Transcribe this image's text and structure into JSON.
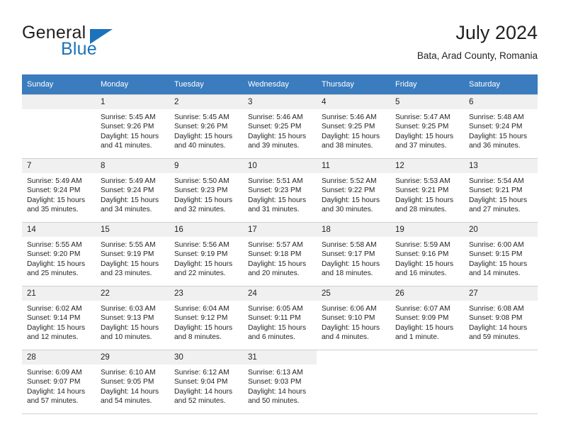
{
  "brand": {
    "word1": "General",
    "word2": "Blue",
    "accent_color": "#1c72bb",
    "logo_icon": "triangle-icon"
  },
  "header": {
    "title": "July 2024",
    "subtitle": "Bata, Arad County, Romania"
  },
  "calendar": {
    "header_bg": "#3a7cbe",
    "daynum_bg": "#f0f0f0",
    "weekday_headers": [
      "Sunday",
      "Monday",
      "Tuesday",
      "Wednesday",
      "Thursday",
      "Friday",
      "Saturday"
    ],
    "weeks": [
      [
        {
          "day": "",
          "lines": []
        },
        {
          "day": "1",
          "lines": [
            "Sunrise: 5:45 AM",
            "Sunset: 9:26 PM",
            "Daylight: 15 hours",
            "and 41 minutes."
          ]
        },
        {
          "day": "2",
          "lines": [
            "Sunrise: 5:45 AM",
            "Sunset: 9:26 PM",
            "Daylight: 15 hours",
            "and 40 minutes."
          ]
        },
        {
          "day": "3",
          "lines": [
            "Sunrise: 5:46 AM",
            "Sunset: 9:25 PM",
            "Daylight: 15 hours",
            "and 39 minutes."
          ]
        },
        {
          "day": "4",
          "lines": [
            "Sunrise: 5:46 AM",
            "Sunset: 9:25 PM",
            "Daylight: 15 hours",
            "and 38 minutes."
          ]
        },
        {
          "day": "5",
          "lines": [
            "Sunrise: 5:47 AM",
            "Sunset: 9:25 PM",
            "Daylight: 15 hours",
            "and 37 minutes."
          ]
        },
        {
          "day": "6",
          "lines": [
            "Sunrise: 5:48 AM",
            "Sunset: 9:24 PM",
            "Daylight: 15 hours",
            "and 36 minutes."
          ]
        }
      ],
      [
        {
          "day": "7",
          "lines": [
            "Sunrise: 5:49 AM",
            "Sunset: 9:24 PM",
            "Daylight: 15 hours",
            "and 35 minutes."
          ]
        },
        {
          "day": "8",
          "lines": [
            "Sunrise: 5:49 AM",
            "Sunset: 9:24 PM",
            "Daylight: 15 hours",
            "and 34 minutes."
          ]
        },
        {
          "day": "9",
          "lines": [
            "Sunrise: 5:50 AM",
            "Sunset: 9:23 PM",
            "Daylight: 15 hours",
            "and 32 minutes."
          ]
        },
        {
          "day": "10",
          "lines": [
            "Sunrise: 5:51 AM",
            "Sunset: 9:23 PM",
            "Daylight: 15 hours",
            "and 31 minutes."
          ]
        },
        {
          "day": "11",
          "lines": [
            "Sunrise: 5:52 AM",
            "Sunset: 9:22 PM",
            "Daylight: 15 hours",
            "and 30 minutes."
          ]
        },
        {
          "day": "12",
          "lines": [
            "Sunrise: 5:53 AM",
            "Sunset: 9:21 PM",
            "Daylight: 15 hours",
            "and 28 minutes."
          ]
        },
        {
          "day": "13",
          "lines": [
            "Sunrise: 5:54 AM",
            "Sunset: 9:21 PM",
            "Daylight: 15 hours",
            "and 27 minutes."
          ]
        }
      ],
      [
        {
          "day": "14",
          "lines": [
            "Sunrise: 5:55 AM",
            "Sunset: 9:20 PM",
            "Daylight: 15 hours",
            "and 25 minutes."
          ]
        },
        {
          "day": "15",
          "lines": [
            "Sunrise: 5:55 AM",
            "Sunset: 9:19 PM",
            "Daylight: 15 hours",
            "and 23 minutes."
          ]
        },
        {
          "day": "16",
          "lines": [
            "Sunrise: 5:56 AM",
            "Sunset: 9:19 PM",
            "Daylight: 15 hours",
            "and 22 minutes."
          ]
        },
        {
          "day": "17",
          "lines": [
            "Sunrise: 5:57 AM",
            "Sunset: 9:18 PM",
            "Daylight: 15 hours",
            "and 20 minutes."
          ]
        },
        {
          "day": "18",
          "lines": [
            "Sunrise: 5:58 AM",
            "Sunset: 9:17 PM",
            "Daylight: 15 hours",
            "and 18 minutes."
          ]
        },
        {
          "day": "19",
          "lines": [
            "Sunrise: 5:59 AM",
            "Sunset: 9:16 PM",
            "Daylight: 15 hours",
            "and 16 minutes."
          ]
        },
        {
          "day": "20",
          "lines": [
            "Sunrise: 6:00 AM",
            "Sunset: 9:15 PM",
            "Daylight: 15 hours",
            "and 14 minutes."
          ]
        }
      ],
      [
        {
          "day": "21",
          "lines": [
            "Sunrise: 6:02 AM",
            "Sunset: 9:14 PM",
            "Daylight: 15 hours",
            "and 12 minutes."
          ]
        },
        {
          "day": "22",
          "lines": [
            "Sunrise: 6:03 AM",
            "Sunset: 9:13 PM",
            "Daylight: 15 hours",
            "and 10 minutes."
          ]
        },
        {
          "day": "23",
          "lines": [
            "Sunrise: 6:04 AM",
            "Sunset: 9:12 PM",
            "Daylight: 15 hours",
            "and 8 minutes."
          ]
        },
        {
          "day": "24",
          "lines": [
            "Sunrise: 6:05 AM",
            "Sunset: 9:11 PM",
            "Daylight: 15 hours",
            "and 6 minutes."
          ]
        },
        {
          "day": "25",
          "lines": [
            "Sunrise: 6:06 AM",
            "Sunset: 9:10 PM",
            "Daylight: 15 hours",
            "and 4 minutes."
          ]
        },
        {
          "day": "26",
          "lines": [
            "Sunrise: 6:07 AM",
            "Sunset: 9:09 PM",
            "Daylight: 15 hours",
            "and 1 minute."
          ]
        },
        {
          "day": "27",
          "lines": [
            "Sunrise: 6:08 AM",
            "Sunset: 9:08 PM",
            "Daylight: 14 hours",
            "and 59 minutes."
          ]
        }
      ],
      [
        {
          "day": "28",
          "lines": [
            "Sunrise: 6:09 AM",
            "Sunset: 9:07 PM",
            "Daylight: 14 hours",
            "and 57 minutes."
          ]
        },
        {
          "day": "29",
          "lines": [
            "Sunrise: 6:10 AM",
            "Sunset: 9:05 PM",
            "Daylight: 14 hours",
            "and 54 minutes."
          ]
        },
        {
          "day": "30",
          "lines": [
            "Sunrise: 6:12 AM",
            "Sunset: 9:04 PM",
            "Daylight: 14 hours",
            "and 52 minutes."
          ]
        },
        {
          "day": "31",
          "lines": [
            "Sunrise: 6:13 AM",
            "Sunset: 9:03 PM",
            "Daylight: 14 hours",
            "and 50 minutes."
          ]
        },
        {
          "day": "",
          "lines": [],
          "blank": true
        },
        {
          "day": "",
          "lines": [],
          "blank": true
        },
        {
          "day": "",
          "lines": [],
          "blank": true
        }
      ]
    ]
  }
}
